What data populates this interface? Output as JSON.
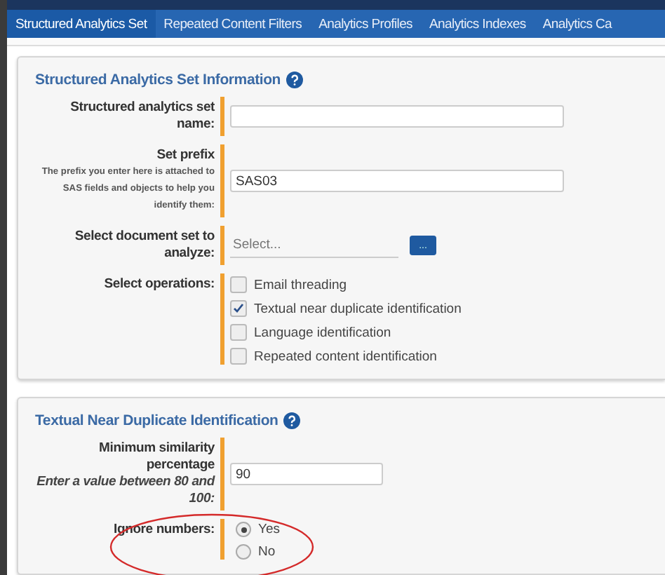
{
  "tabs": [
    {
      "label": "Structured Analytics Set",
      "selected": true
    },
    {
      "label": "Repeated Content Filters",
      "selected": false
    },
    {
      "label": "Analytics Profiles",
      "selected": false
    },
    {
      "label": "Analytics Indexes",
      "selected": false
    },
    {
      "label": "Analytics Ca",
      "selected": false
    }
  ],
  "sections": [
    {
      "title": "Structured Analytics Set Information",
      "fields": [
        {
          "kind": "text",
          "label": "Structured analytics set name:"
        },
        {
          "kind": "text",
          "label": "Set prefix",
          "hint": "The prefix you enter here is attached to SAS fields and objects to help you identify them:",
          "value": "SAS03"
        },
        {
          "kind": "picker",
          "label": "Select document set to analyze:",
          "placeholder": "Select...",
          "button": "..."
        },
        {
          "kind": "checklist",
          "label": "Select operations:",
          "options": [
            {
              "label": "Email threading",
              "checked": false
            },
            {
              "label": "Textual near duplicate identification",
              "checked": true
            },
            {
              "label": "Language identification",
              "checked": false
            },
            {
              "label": "Repeated content identification",
              "checked": false
            }
          ]
        }
      ]
    },
    {
      "title": "Textual Near Duplicate Identification",
      "fields": [
        {
          "kind": "number",
          "label": "Minimum similarity percentage",
          "hint": "Enter a value between 80 and 100:",
          "value": "90"
        },
        {
          "kind": "radio",
          "label": "Ignore numbers:",
          "options": [
            {
              "label": "Yes",
              "selected": true
            },
            {
              "label": "No",
              "selected": false
            }
          ]
        }
      ]
    }
  ],
  "annotation": {
    "kind": "ellipse",
    "color": "#d42a2a"
  }
}
